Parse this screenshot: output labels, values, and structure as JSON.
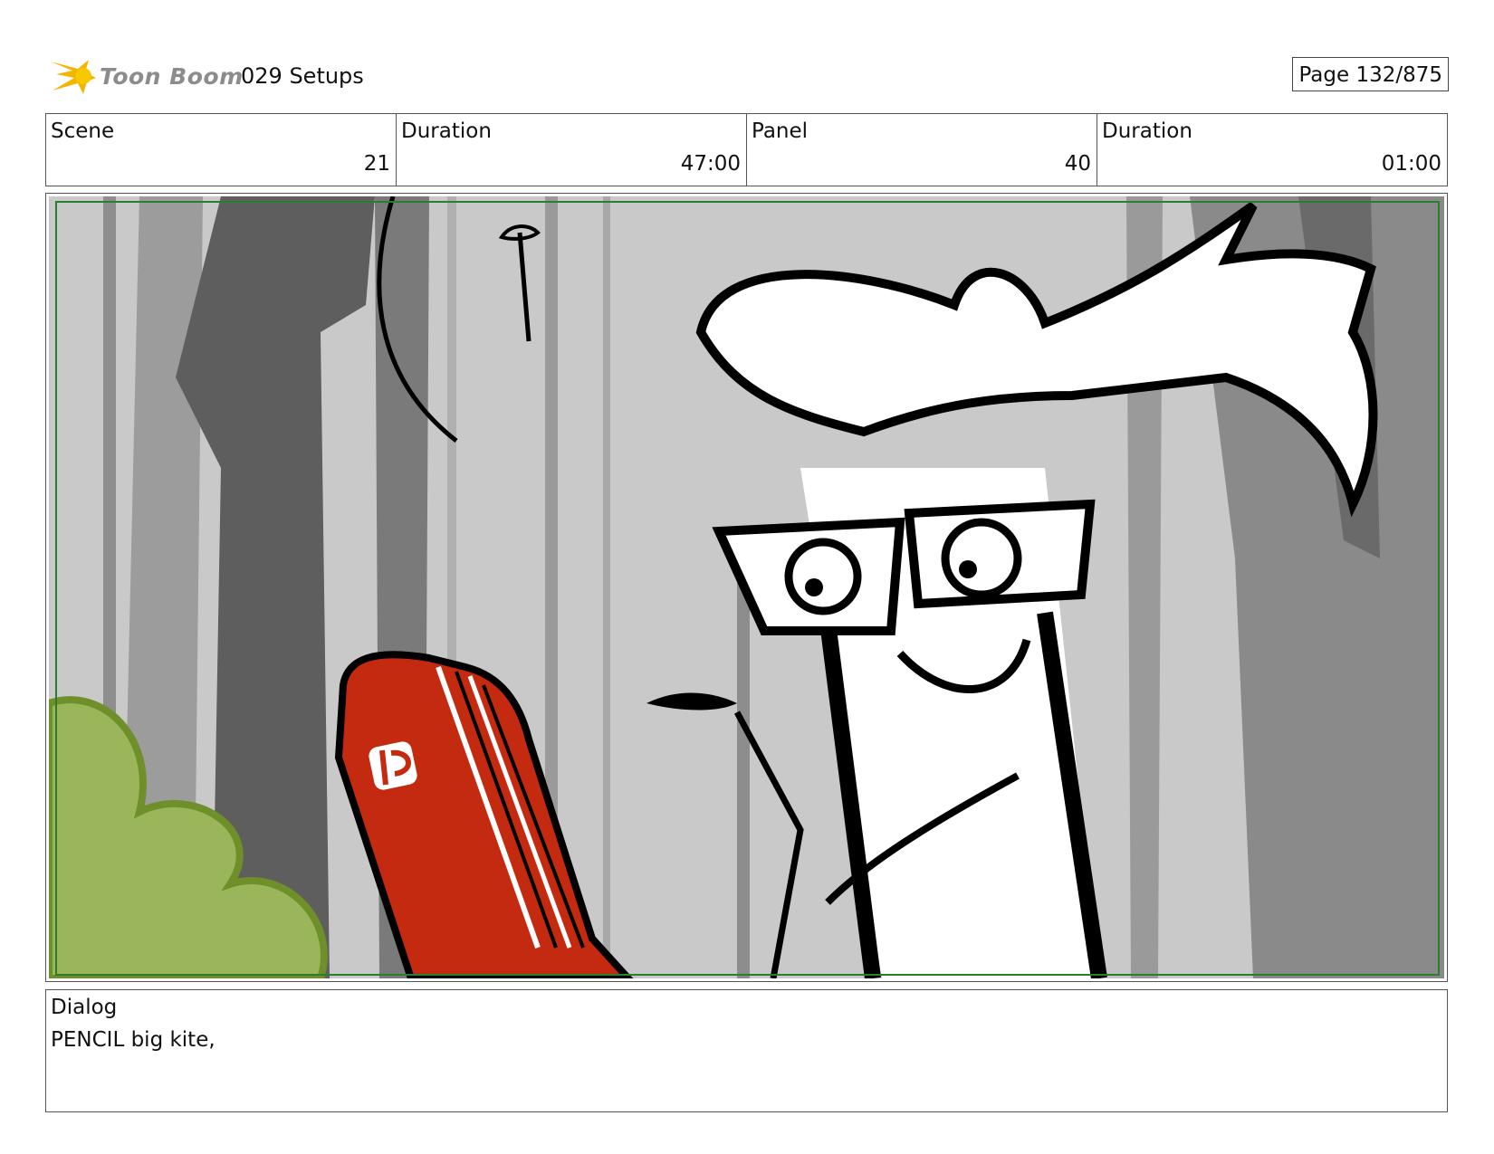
{
  "header": {
    "logo_text": "Toon Boom",
    "logo_icon": "toon-boom-star-icon",
    "document_title": "029 Setups",
    "page_indicator": "Page 132/875"
  },
  "info": {
    "cells": [
      {
        "label": "Scene",
        "value": "21"
      },
      {
        "label": "Duration",
        "value": "47:00"
      },
      {
        "label": "Panel",
        "value": "40"
      },
      {
        "label": "Duration",
        "value": "01:00"
      }
    ]
  },
  "panel": {
    "frame_color": "#2e7d2e",
    "book_color": "#c42a10",
    "bush_color": "#9bb55a"
  },
  "dialog": {
    "label": "Dialog",
    "text": "PENCIL big kite,"
  }
}
